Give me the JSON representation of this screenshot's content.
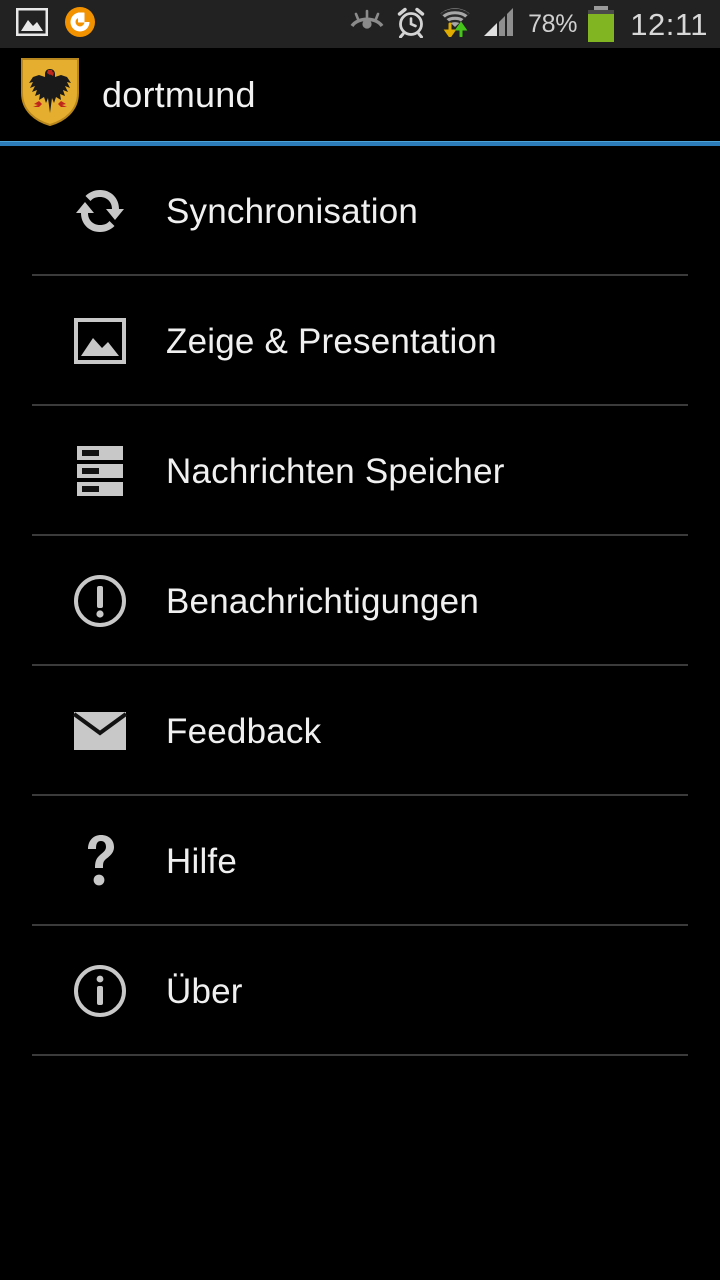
{
  "status_bar": {
    "background": "#222222",
    "left_icons": [
      {
        "name": "screenshot-image-icon",
        "label": "Screenshot"
      },
      {
        "name": "app-notification-icon",
        "label": "App",
        "color": "#f39200"
      }
    ],
    "right_icons": [
      {
        "name": "smart-stay-eye-icon",
        "label": "Smart stay"
      },
      {
        "name": "alarm-clock-icon",
        "label": "Alarm"
      },
      {
        "name": "wifi-data-transfer-icon",
        "label": "Wi-Fi"
      },
      {
        "name": "signal-bars-icon",
        "label": "Signal"
      }
    ],
    "battery_percent": "78%",
    "battery_level": 78,
    "battery_color": "#82b522",
    "clock": "12:11"
  },
  "header": {
    "logo_name": "dortmund-coat-of-arms",
    "title": "dortmund",
    "accent_color": "#2b7cb8"
  },
  "settings": {
    "items": [
      {
        "icon": "sync-icon",
        "label": "Synchronisation"
      },
      {
        "icon": "image-icon",
        "label": "Zeige & Presentation"
      },
      {
        "icon": "storage-icon",
        "label": "Nachrichten Speicher"
      },
      {
        "icon": "alert-circle-icon",
        "label": "Benachrichtigungen"
      },
      {
        "icon": "envelope-icon",
        "label": "Feedback"
      },
      {
        "icon": "question-mark-icon",
        "label": "Hilfe"
      },
      {
        "icon": "info-circle-icon",
        "label": "Über"
      }
    ]
  }
}
